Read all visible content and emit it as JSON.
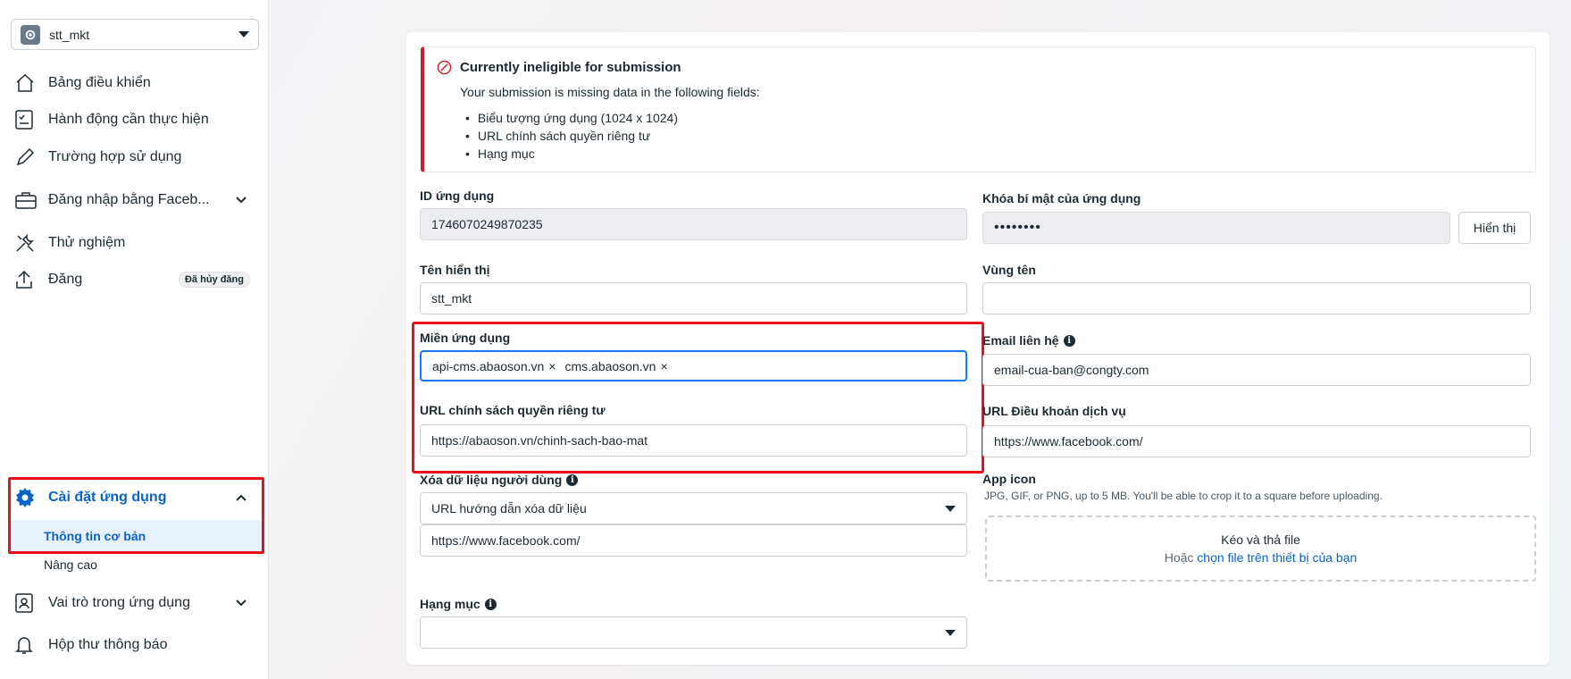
{
  "sidebar": {
    "app_selector": {
      "name": "stt_mkt",
      "icon": "gear-icon"
    },
    "items": [
      {
        "label": "Bảng điều khiển",
        "icon": "home-icon"
      },
      {
        "label": "Hành động cần thực hiện",
        "icon": "checklist-icon"
      },
      {
        "label": "Trường hợp sử dụng",
        "icon": "pencil-icon"
      },
      {
        "label": "Đăng nhập bằng Faceb...",
        "icon": "briefcase-icon"
      },
      {
        "label": "Thử nghiệm",
        "icon": "tools-icon"
      },
      {
        "label": "Đăng",
        "icon": "upload-icon",
        "badge": "Đã hủy đăng"
      }
    ],
    "settings": {
      "label": "Cài đặt ứng dụng",
      "icon": "gear-icon",
      "sub_items": [
        "Thông tin cơ bản",
        "Nâng cao"
      ],
      "active": "Thông tin cơ bản"
    },
    "bottom_items": [
      {
        "label": "Vai trò trong ứng dụng",
        "icon": "person-badge-icon"
      },
      {
        "label": "Hộp thư thông báo",
        "icon": "bell-icon"
      }
    ]
  },
  "alert": {
    "title": "Currently ineligible for submission",
    "description": "Your submission is missing data in the following fields:",
    "missing": [
      "Biểu tượng ứng dụng (1024 x 1024)",
      "URL chính sách quyền riêng tư",
      "Hạng mục"
    ]
  },
  "form": {
    "app_id": {
      "label": "ID ứng dụng",
      "value": "1746070249870235"
    },
    "app_secret": {
      "label": "Khóa bí mật của ứng dụng",
      "value": "••••••••",
      "show_button": "Hiển thị"
    },
    "display_name": {
      "label": "Tên hiển thị",
      "value": "stt_mkt"
    },
    "namespace": {
      "label": "Vùng tên",
      "value": ""
    },
    "app_domains": {
      "label": "Miền ứng dụng",
      "tags": [
        "api-cms.abaoson.vn",
        "cms.abaoson.vn"
      ],
      "remove_glyph": "×"
    },
    "contact_email": {
      "label": "Email liên hệ",
      "value": "email-cua-ban@congty.com"
    },
    "privacy_url": {
      "label": "URL chính sách quyền riêng tư",
      "value": "https://abaoson.vn/chinh-sach-bao-mat"
    },
    "tos_url": {
      "label": "URL Điều khoản dịch vụ",
      "value": "https://www.facebook.com/"
    },
    "data_deletion": {
      "label": "Xóa dữ liệu người dùng",
      "select_value": "URL hướng dẫn xóa dữ liệu",
      "value": "https://www.facebook.com/"
    },
    "app_icon": {
      "label": "App icon",
      "hint": "JPG, GIF, or PNG, up to 5 MB. You'll be able to crop it to a square before uploading.",
      "drop_text": "Kéo và thả file",
      "or_text": "Hoặc",
      "choose_link": "chọn file trên thiết bị của bạn"
    },
    "category": {
      "label": "Hạng mục",
      "value": ""
    }
  },
  "colors": {
    "accent": "#0a63c9",
    "alert_red": "#d0192b",
    "annotation_red": "#e8101a"
  }
}
